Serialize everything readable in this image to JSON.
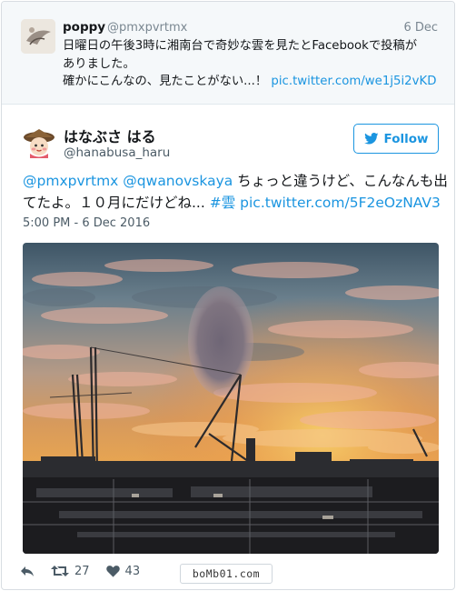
{
  "parent_tweet": {
    "display_name": "poppy",
    "handle": "@pmxpvrtmx",
    "date": "6 Dec",
    "lines": [
      "日曜日の午後3時に湘南台で奇妙な雲を見たとFacebookで投稿が",
      "ありました。"
    ],
    "line3_text": "確かにこんなの、見たことがない...！ ",
    "line3_link": "pic.twitter.com/we1j5i2vKD"
  },
  "main_tweet": {
    "display_name": "はなぶさ はる",
    "handle": "@hanabusa_haru",
    "follow_label": "Follow",
    "mention1": "@pmxpvrtmx",
    "mention2": "@qwanovskaya",
    "line1_text": " ちょっと違うけど、こんなんも出",
    "line2_text": "てたよ。１０月にだけどね... ",
    "hashtag": "#雲",
    "photo_link": "pic.twitter.com/5F2eOzNAV3",
    "timestamp": "5:00 PM - 6 Dec 2016"
  },
  "actions": {
    "retweet_count": "27",
    "like_count": "43"
  },
  "watermark": "boMb01.com",
  "colors": {
    "link": "#1b95e0",
    "secondary_text": "#4b5b66",
    "parent_background": "#f5f8fa"
  },
  "icons": [
    "reply-icon",
    "retweet-icon",
    "heart-icon",
    "twitter-bird-icon"
  ]
}
